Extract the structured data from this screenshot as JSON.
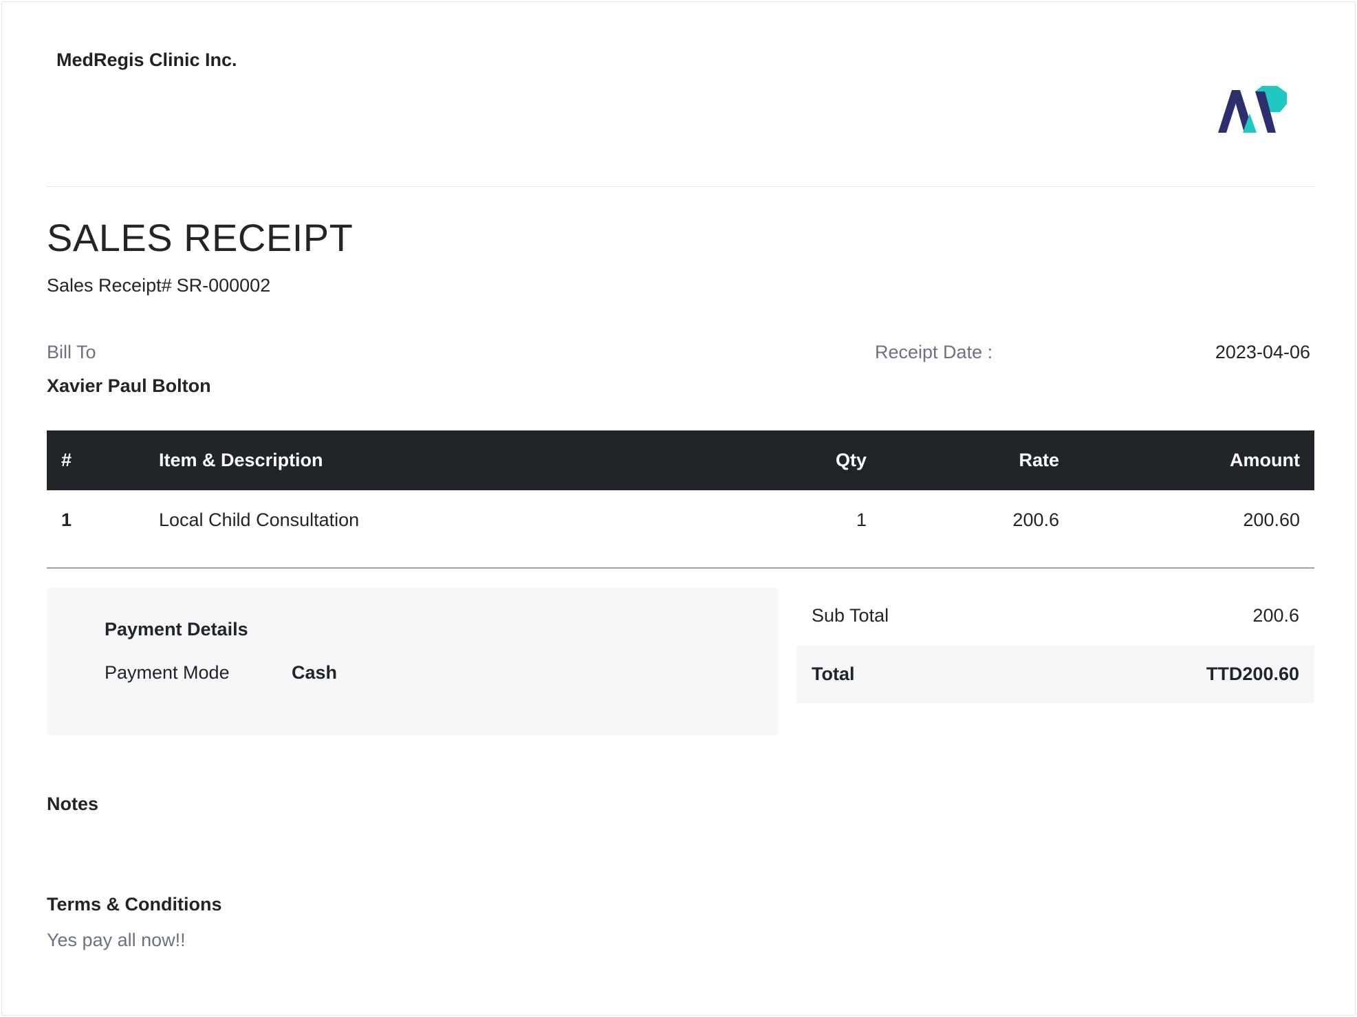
{
  "company": {
    "name": "MedRegis Clinic Inc.",
    "logo_icon": "medregis-logo-icon",
    "logo_colors": {
      "dark": "#2d2e6e",
      "accent": "#1fc8c0"
    }
  },
  "document": {
    "title": "SALES RECEIPT",
    "number_label": "Sales Receipt#",
    "number": "SR-000002"
  },
  "bill_to": {
    "label": "Bill To",
    "name": "Xavier Paul Bolton"
  },
  "receipt_date": {
    "label": "Receipt Date :",
    "value": "2023-04-06"
  },
  "items_table": {
    "headers": [
      "#",
      "Item & Description",
      "Qty",
      "Rate",
      "Amount"
    ],
    "rows": [
      [
        "1",
        "Local Child Consultation",
        "1",
        "200.6",
        "200.60"
      ]
    ]
  },
  "payment": {
    "title": "Payment Details",
    "mode_label": "Payment Mode",
    "mode_value": "Cash"
  },
  "totals": {
    "subtotal_label": "Sub Total",
    "subtotal_value": "200.6",
    "total_label": "Total",
    "total_value": "TTD200.60"
  },
  "notes": {
    "label": "Notes"
  },
  "terms": {
    "label": "Terms & Conditions",
    "text": "Yes pay all now!!"
  },
  "colors": {
    "header_bg": "#212529",
    "muted_text": "#6b7280",
    "panel_bg": "#f6f7f9"
  }
}
